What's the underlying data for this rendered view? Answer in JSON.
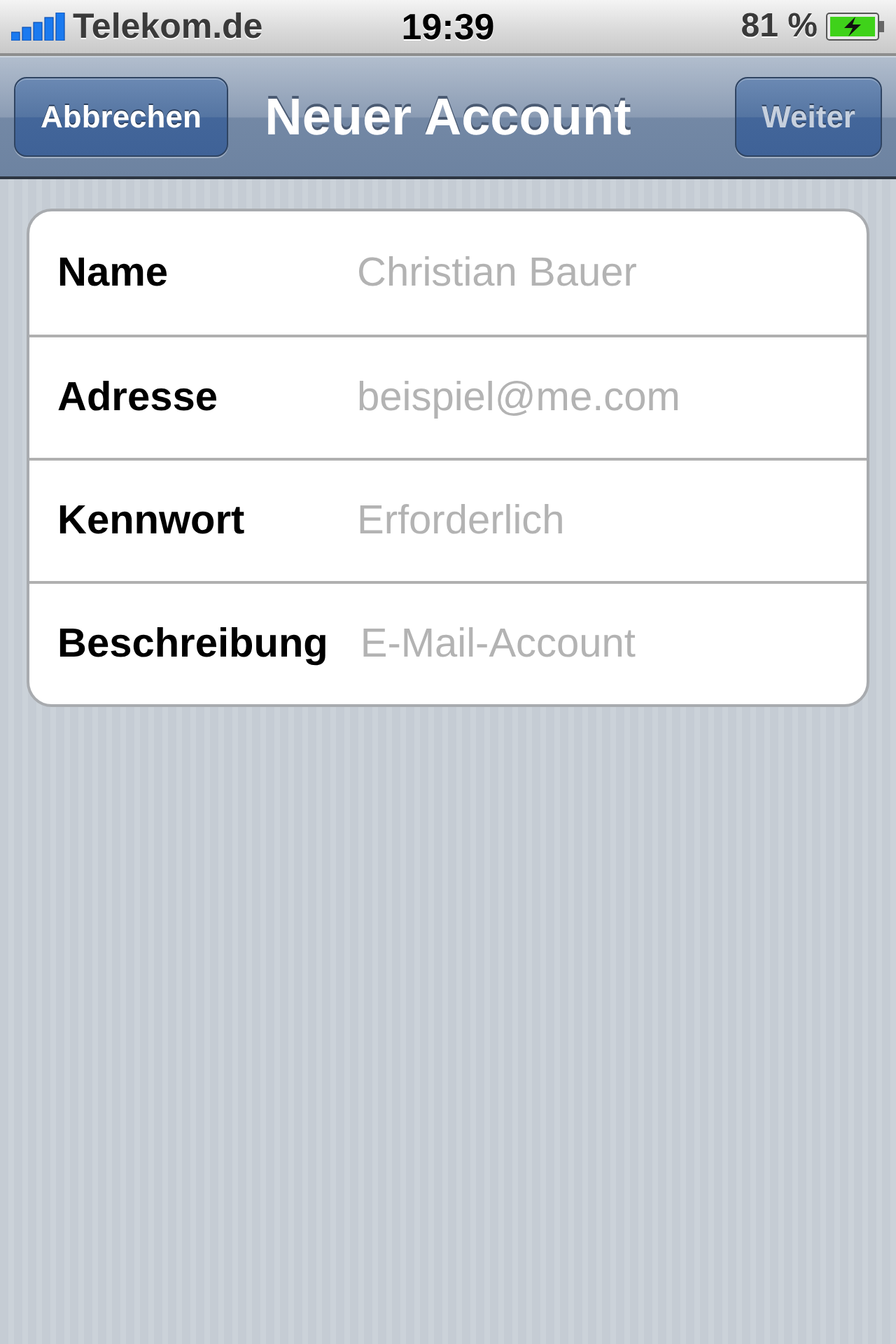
{
  "status_bar": {
    "carrier": "Telekom.de",
    "time": "19:39",
    "battery": "81 %"
  },
  "nav_bar": {
    "left_button": {
      "label": "Abbrechen",
      "disabled": false
    },
    "title": "Neuer Account",
    "right_button": {
      "label": "Weiter",
      "disabled": true
    }
  },
  "form": {
    "fields": [
      {
        "label": "Name",
        "placeholder": "Christian Bauer"
      },
      {
        "label": "Adresse",
        "placeholder": "beispiel@me.com"
      },
      {
        "label": "Kennwort",
        "placeholder": "Erforderlich"
      },
      {
        "label": "Beschreibung",
        "placeholder": "E-Mail-Account"
      }
    ]
  }
}
